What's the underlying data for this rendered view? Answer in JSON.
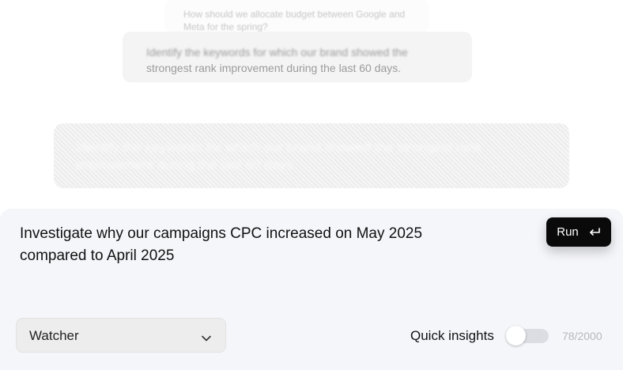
{
  "suggestions": {
    "top_text": "How should we allocate budget between Google and Meta for the spring?",
    "mid_text_line1": "Identify the keywords for which our brand showed the",
    "mid_text_line2": "strongest rank improvement during the last 60 days.",
    "big_text": "Identify the keywords for which our brand showed the strongest rank improvement during the last 60 days."
  },
  "composer": {
    "prompt_line1": "Investigate why our campaigns CPC increased on May 2025",
    "prompt_line2": "compared to April 2025",
    "run_label": "Run",
    "agent_selected": "Watcher",
    "quick_insights_label": "Quick insights",
    "quick_insights_on": false,
    "char_count": "78/2000"
  }
}
